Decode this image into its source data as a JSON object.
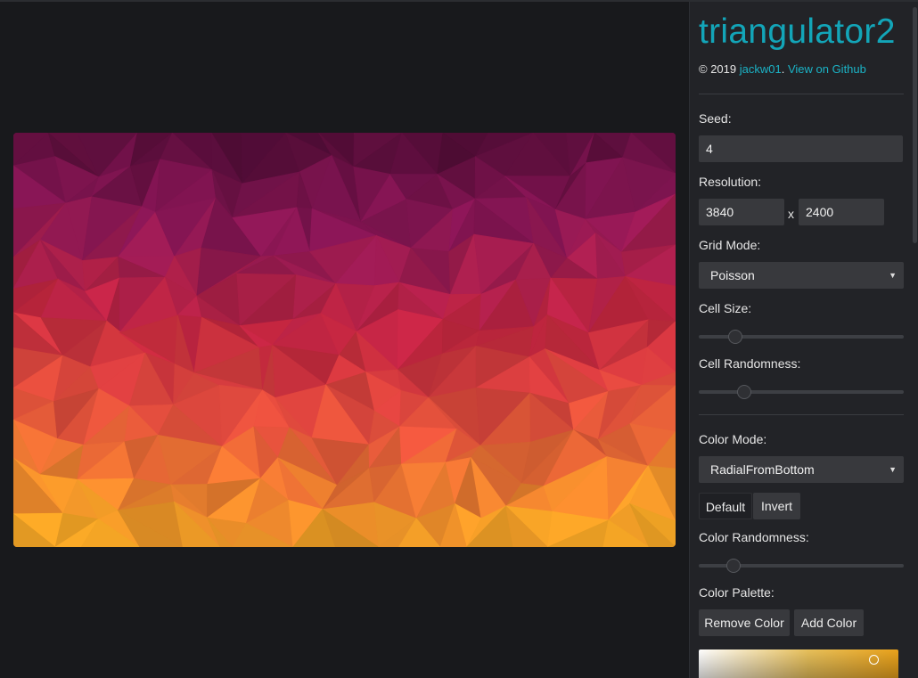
{
  "app": {
    "title": "triangulator2",
    "copyright_prefix": "© 2019 ",
    "author": "jackw01",
    "separator": ". ",
    "github_link": "View on Github"
  },
  "preview": {
    "description_colors": {
      "top": "#4a0b32",
      "upper": "#8a1656",
      "middle": "#c3263f",
      "lower": "#e2553a",
      "bottom": "#eb9f24"
    }
  },
  "controls": {
    "seed": {
      "label": "Seed:",
      "value": "4"
    },
    "resolution": {
      "label": "Resolution:",
      "width": "3840",
      "times": "x",
      "height": "2400"
    },
    "grid_mode": {
      "label": "Grid Mode:",
      "selected": "Poisson"
    },
    "cell_size": {
      "label": "Cell Size:",
      "position": 0.18
    },
    "cell_randomness": {
      "label": "Cell Randomness:",
      "position": 0.22
    },
    "color_mode": {
      "label": "Color Mode:",
      "selected": "RadialFromBottom"
    },
    "orientation_buttons": {
      "default_label": "Default",
      "invert_label": "Invert",
      "active": "Default"
    },
    "color_randomness": {
      "label": "Color Randomness:",
      "position": 0.17
    },
    "color_palette": {
      "label": "Color Palette:",
      "remove_label": "Remove Color",
      "add_label": "Add Color"
    }
  },
  "colors": {
    "accent": "#13a5b8",
    "panel_bg": "#222327",
    "field_bg": "#38393d",
    "page_bg": "#18191c"
  }
}
